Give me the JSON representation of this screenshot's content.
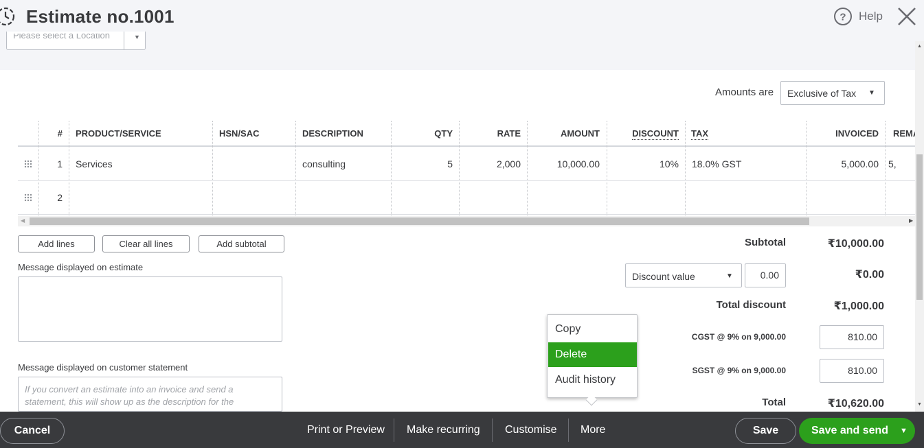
{
  "header": {
    "title": "Estimate no.1001",
    "location_placeholder": "Please select a Location",
    "help_label": "Help"
  },
  "amounts": {
    "label": "Amounts are",
    "value": "Exclusive of Tax"
  },
  "table": {
    "headers": [
      "#",
      "PRODUCT/SERVICE",
      "HSN/SAC",
      "DESCRIPTION",
      "QTY",
      "RATE",
      "AMOUNT",
      "DISCOUNT",
      "TAX",
      "INVOICED",
      "REMA"
    ],
    "rows": [
      {
        "num": "1",
        "product": "Services",
        "hsn": "",
        "description": "consulting",
        "qty": "5",
        "rate": "2,000",
        "amount": "10,000.00",
        "discount": "10%",
        "tax": "18.0% GST",
        "invoiced": "5,000.00",
        "remaining": "5,"
      },
      {
        "num": "2",
        "product": "",
        "hsn": "",
        "description": "",
        "qty": "",
        "rate": "",
        "amount": "",
        "discount": "",
        "tax": "",
        "invoiced": "",
        "remaining": ""
      }
    ]
  },
  "actions": {
    "add_lines": "Add lines",
    "clear_all": "Clear all lines",
    "add_subtotal": "Add subtotal"
  },
  "messages": {
    "estimate_label": "Message displayed on estimate",
    "statement_label": "Message displayed on customer statement",
    "statement_placeholder": "If you convert an estimate into an invoice and send a statement, this will show up as the description for the"
  },
  "totals": {
    "subtotal_label": "Subtotal",
    "subtotal_value": "₹10,000.00",
    "discount_type": "Discount value",
    "discount_input": "0.00",
    "discount_amount": "₹0.00",
    "total_discount_label": "Total discount",
    "total_discount_value": "₹1,000.00",
    "cgst_label": "CGST @ 9% on 9,000.00",
    "cgst_value": "810.00",
    "sgst_label": "SGST @ 9% on 9,000.00",
    "sgst_value": "810.00",
    "total_label": "Total",
    "total_value": "₹10,620.00"
  },
  "more_menu": {
    "items": [
      "Copy",
      "Delete",
      "Audit history"
    ],
    "selected": "Delete"
  },
  "footer": {
    "cancel": "Cancel",
    "print_preview": "Print or Preview",
    "make_recurring": "Make recurring",
    "customise": "Customise",
    "more": "More",
    "save": "Save",
    "save_and_send": "Save and send"
  },
  "colors": {
    "accent_green": "#2ca01c",
    "footer_bg": "#393a3d",
    "header_bg": "#f4f5f8"
  }
}
